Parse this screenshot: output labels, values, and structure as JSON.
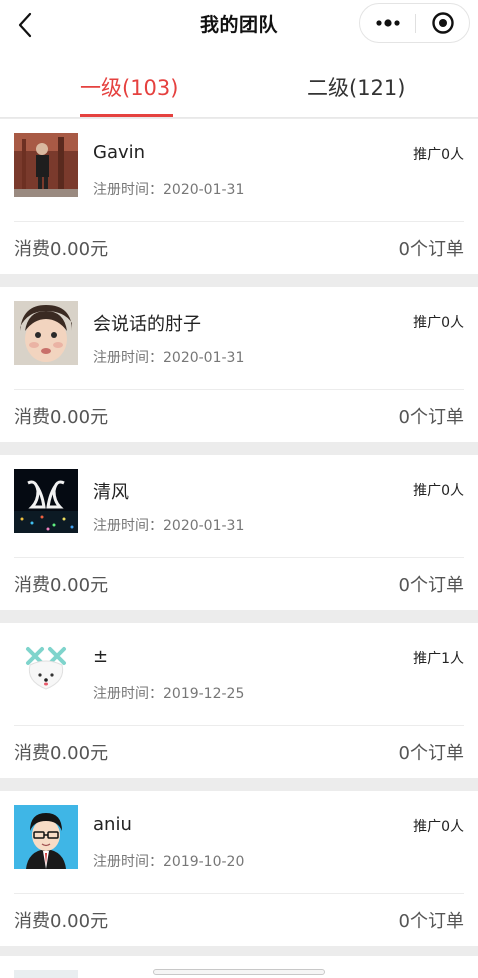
{
  "header": {
    "title": "我的团队",
    "back_icon": "chevron-left-icon",
    "more_icon": "more-dots-icon",
    "close_icon": "target-close-icon"
  },
  "tabs": [
    {
      "label": "一级(103)",
      "active": true
    },
    {
      "label": "二级(121)",
      "active": false
    }
  ],
  "colors": {
    "accent": "#e5413f",
    "background": "#ececec"
  },
  "members": [
    {
      "name": "Gavin",
      "registered": "注册时间：2020-01-31",
      "promotion": "推广0人",
      "spend": "消费0.00元",
      "orders": "0个订单"
    },
    {
      "name": "会说话的肘子",
      "registered": "注册时间：2020-01-31",
      "promotion": "推广0人",
      "spend": "消费0.00元",
      "orders": "0个订单"
    },
    {
      "name": "清风",
      "registered": "注册时间：2020-01-31",
      "promotion": "推广0人",
      "spend": "消费0.00元",
      "orders": "0个订单"
    },
    {
      "name": "±",
      "registered": "注册时间：2019-12-25",
      "promotion": "推广1人",
      "spend": "消费0.00元",
      "orders": "0个订单"
    },
    {
      "name": "aniu",
      "registered": "注册时间：2019-10-20",
      "promotion": "推广0人",
      "spend": "消费0.00元",
      "orders": "0个订单"
    }
  ]
}
